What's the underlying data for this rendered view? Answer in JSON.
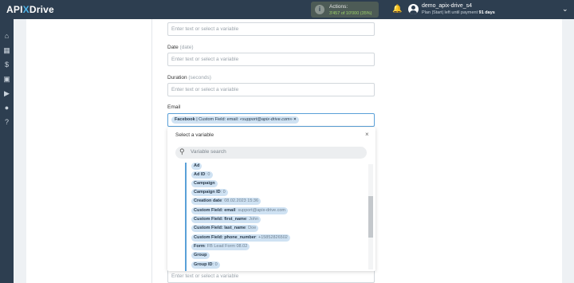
{
  "brand": {
    "logo_left": "API",
    "logo_x": "X",
    "logo_right": "Drive"
  },
  "header": {
    "actions_label": "Actions:",
    "actions_value": "3'457 of 10'000 (35%)",
    "username": "demo_apix-drive_s4",
    "plan_prefix": "Plan |Start| left until payment",
    "plan_days": "91 days"
  },
  "fields": [
    {
      "label": "Date",
      "sub": "(date)",
      "placeholder": "Enter text or select a variable"
    },
    {
      "label": "Duration",
      "sub": "(seconds)",
      "placeholder": "Enter text or select a variable"
    },
    {
      "label": "Email",
      "sub": "",
      "placeholder": ""
    }
  ],
  "top_input_placeholder": "Enter text or select a variable",
  "bottom_input_placeholder": "Enter text or select a variable",
  "email_tag": {
    "source": "Facebook",
    "middle": "| Custom Field: email:",
    "value": "«support@apix-drive.com»",
    "remove": "×"
  },
  "dropdown": {
    "title": "Select a variable",
    "close": "×",
    "search_placeholder": "Variable search",
    "items": [
      {
        "name": "Ad",
        "value": ""
      },
      {
        "name": "Ad ID",
        "value": ": 0"
      },
      {
        "name": "Campaign",
        "value": ""
      },
      {
        "name": "Campaign ID",
        "value": ": 0"
      },
      {
        "name": "Creation date",
        "value": ": 08.02.2023 15:36"
      },
      {
        "name": "Custom Field: email",
        "value": ": support@apix-drive.com"
      },
      {
        "name": "Custom Field: first_name",
        "value": ": John"
      },
      {
        "name": "Custom Field: last_name",
        "value": ": Doe"
      },
      {
        "name": "Custom Field: phone_number",
        "value": ": +15852826502"
      },
      {
        "name": "Form",
        "value": ": FB Lead Form 08.02"
      },
      {
        "name": "Group",
        "value": ""
      },
      {
        "name": "Group ID",
        "value": ": 0"
      }
    ]
  },
  "sidebar_icons": [
    "home-icon",
    "sitemap-icon",
    "dollar-icon",
    "briefcase-icon",
    "youtube-icon",
    "user-icon",
    "help-icon"
  ],
  "colors": {
    "topbar": "#2d3e50",
    "accent": "#5aa0d8",
    "tag": "#cfe2f3",
    "actions_value": "#9ed36a"
  }
}
